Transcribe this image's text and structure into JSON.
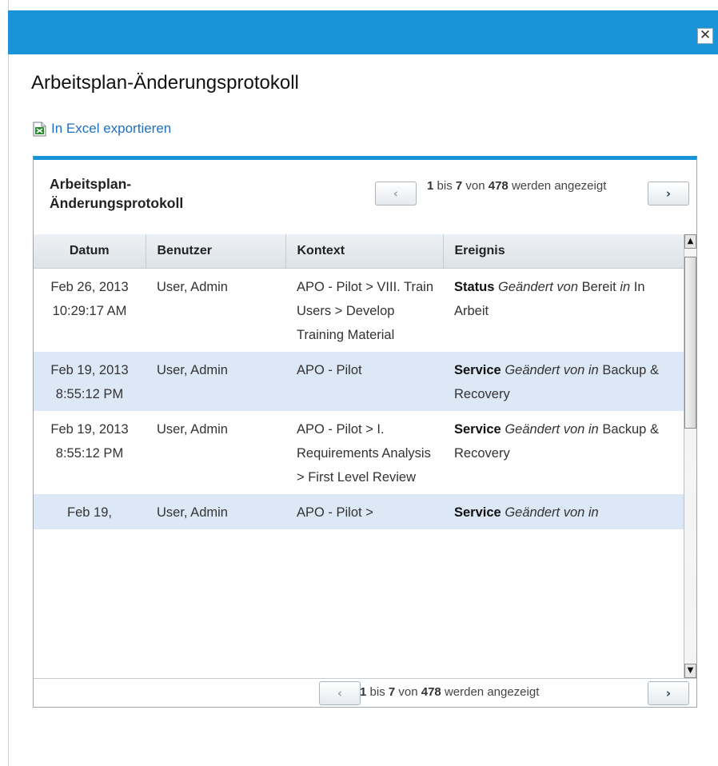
{
  "dialog": {
    "close_glyph": "✕",
    "title": "Arbeitsplan-Änderungsprotokoll",
    "export_label": "In Excel exportieren"
  },
  "panel": {
    "title": "Arbeitsplan-Änderungsprotokoll",
    "pager_prev": "‹",
    "pager_next": "›",
    "pager_from": "1",
    "pager_to": "7",
    "pager_total": "478",
    "pager_bis": "bis",
    "pager_von": "von",
    "pager_suffix": "werden angezeigt",
    "columns": [
      "Datum",
      "Benutzer",
      "Kontext",
      "Ereignis"
    ],
    "rows": [
      {
        "date": "Feb 26, 2013 10:29:17 AM",
        "user": "User, Admin",
        "context": "APO - Pilot > VIII. Train Users > Develop Training Material",
        "event_field": "Status",
        "event_changed": "Geändert von",
        "event_from": "Bereit",
        "event_in": "in",
        "event_to": "In Arbeit"
      },
      {
        "date": "Feb 19, 2013 8:55:12 PM",
        "user": "User, Admin",
        "context": "APO - Pilot",
        "event_field": "Service",
        "event_changed": "Geändert von in",
        "event_from": "",
        "event_in": "",
        "event_to": "Backup & Recovery"
      },
      {
        "date": "Feb 19, 2013 8:55:12 PM",
        "user": "User, Admin",
        "context": "APO - Pilot > I. Requirements Analysis > First Level Review",
        "event_field": "Service",
        "event_changed": "Geändert von in",
        "event_from": "",
        "event_in": "",
        "event_to": "Backup & Recovery"
      },
      {
        "date": "Feb 19,",
        "user": "User, Admin",
        "context": "APO - Pilot >",
        "event_field": "Service",
        "event_changed": "Geändert von in",
        "event_from": "",
        "event_in": "",
        "event_to": ""
      }
    ]
  },
  "scrollbar": {
    "up": "▲",
    "down": "▼"
  },
  "colors": {
    "accent": "#1a94d8",
    "row_alt": "#dde8f6",
    "link": "#1f6fc0"
  }
}
